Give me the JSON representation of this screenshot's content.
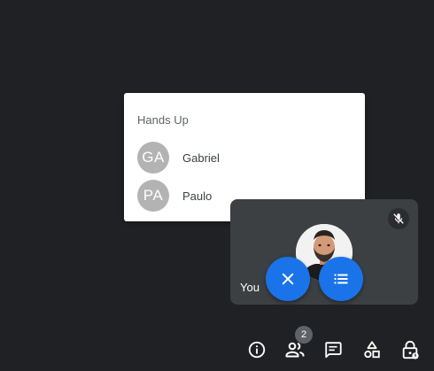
{
  "hands_up": {
    "title": "Hands Up",
    "people": [
      {
        "initials": "GA",
        "name": "Gabriel"
      },
      {
        "initials": "PA",
        "name": "Paulo"
      }
    ]
  },
  "self_tile": {
    "label": "You",
    "mic_icon": "mic-off-icon"
  },
  "fab": {
    "close_icon": "close-icon",
    "list_icon": "list-icon"
  },
  "toolbar": {
    "people_count": "2",
    "icons": [
      "info-icon",
      "people-icon",
      "chat-icon",
      "activities-icon",
      "host-controls-icon"
    ]
  },
  "colors": {
    "background": "#202124",
    "accent": "#1a73e8",
    "tile": "#3c4043",
    "avatar": "#b3b3b3"
  }
}
